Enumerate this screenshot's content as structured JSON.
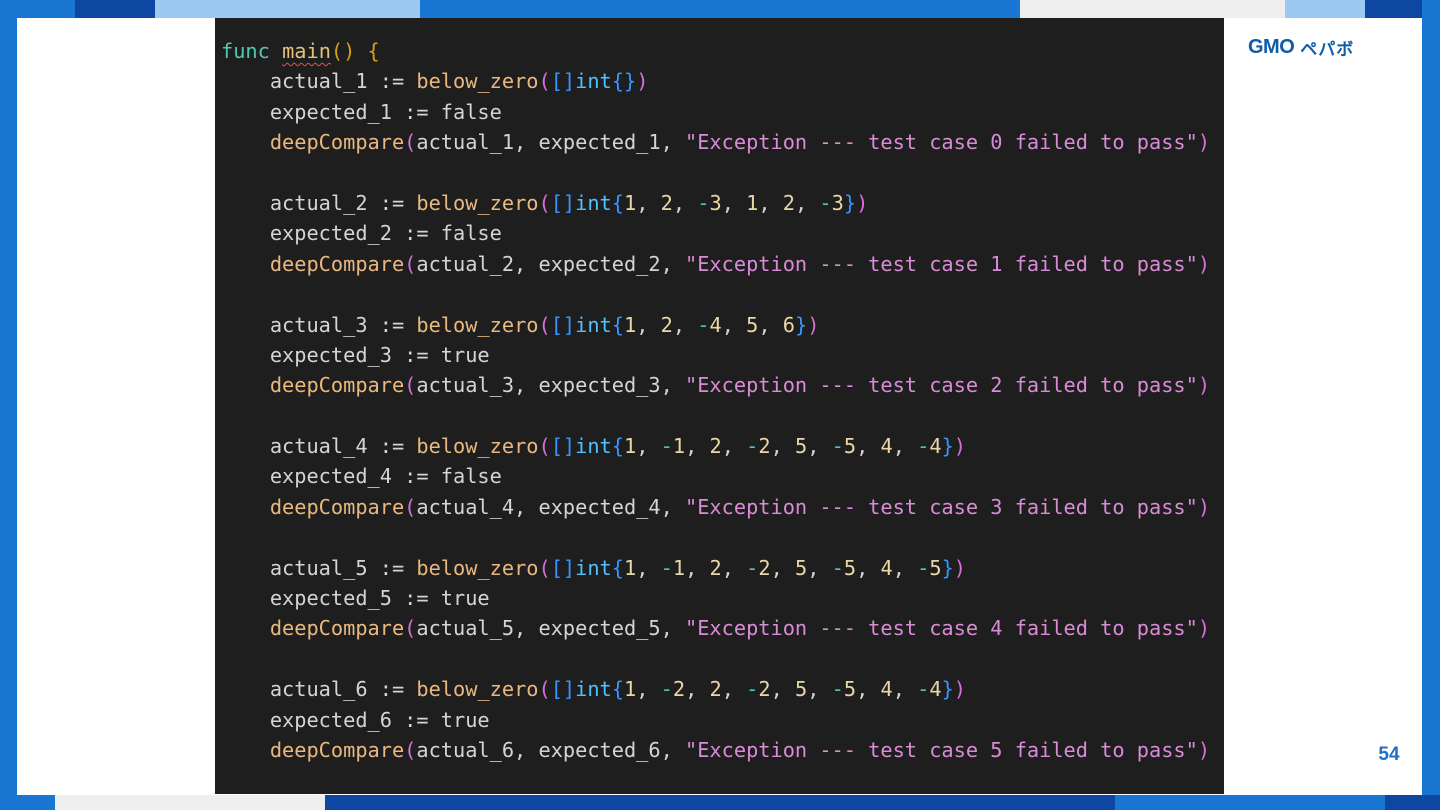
{
  "colors": {
    "frame_blue": "#1976d2",
    "frame_light_blue": "#9cc9f2",
    "frame_dark_blue": "#0d47a1",
    "slide_background": "#ffffff",
    "code_background": "#1e1e1e",
    "brand_blue": "#0f5ca8",
    "page_number": "#1f6fc5"
  },
  "brand": {
    "logo_latin": "GMO",
    "logo_japanese": "ペパボ"
  },
  "page_number": "54",
  "code": {
    "language": "go",
    "lines": [
      [
        {
          "t": "func",
          "c": "kw"
        },
        {
          "t": " ",
          "c": "plain"
        },
        {
          "t": "main",
          "c": "fn",
          "sq": true
        },
        {
          "t": "()",
          "c": "br1"
        },
        {
          "t": " ",
          "c": "plain"
        },
        {
          "t": "{",
          "c": "br1"
        }
      ],
      [
        {
          "t": "    actual_1 ",
          "c": "id"
        },
        {
          "t": ":=",
          "c": "op"
        },
        {
          "t": " ",
          "c": "plain"
        },
        {
          "t": "below_zero",
          "c": "call"
        },
        {
          "t": "(",
          "c": "br2"
        },
        {
          "t": "[]",
          "c": "br3"
        },
        {
          "t": "int",
          "c": "type"
        },
        {
          "t": "{}",
          "c": "br3"
        },
        {
          "t": ")",
          "c": "br2"
        }
      ],
      [
        {
          "t": "    expected_1 ",
          "c": "id"
        },
        {
          "t": ":=",
          "c": "op"
        },
        {
          "t": " false",
          "c": "id"
        }
      ],
      [
        {
          "t": "    deepCompare",
          "c": "call"
        },
        {
          "t": "(",
          "c": "br2"
        },
        {
          "t": "actual_1, expected_1, ",
          "c": "id"
        },
        {
          "t": "\"Exception --- test case 0 failed to pass\"",
          "c": "str"
        },
        {
          "t": ")",
          "c": "br2"
        }
      ],
      [],
      [
        {
          "t": "    actual_2 ",
          "c": "id"
        },
        {
          "t": ":=",
          "c": "op"
        },
        {
          "t": " ",
          "c": "plain"
        },
        {
          "t": "below_zero",
          "c": "call"
        },
        {
          "t": "(",
          "c": "br2"
        },
        {
          "t": "[]",
          "c": "br3"
        },
        {
          "t": "int",
          "c": "type"
        },
        {
          "t": "{",
          "c": "br3"
        },
        {
          "t": "1",
          "c": "num"
        },
        {
          "t": ", ",
          "c": "id"
        },
        {
          "t": "2",
          "c": "num"
        },
        {
          "t": ", ",
          "c": "id"
        },
        {
          "t": "-",
          "c": "neg"
        },
        {
          "t": "3",
          "c": "num"
        },
        {
          "t": ", ",
          "c": "id"
        },
        {
          "t": "1",
          "c": "num"
        },
        {
          "t": ", ",
          "c": "id"
        },
        {
          "t": "2",
          "c": "num"
        },
        {
          "t": ", ",
          "c": "id"
        },
        {
          "t": "-",
          "c": "neg"
        },
        {
          "t": "3",
          "c": "num"
        },
        {
          "t": "}",
          "c": "br3"
        },
        {
          "t": ")",
          "c": "br2"
        }
      ],
      [
        {
          "t": "    expected_2 ",
          "c": "id"
        },
        {
          "t": ":=",
          "c": "op"
        },
        {
          "t": " false",
          "c": "id"
        }
      ],
      [
        {
          "t": "    deepCompare",
          "c": "call"
        },
        {
          "t": "(",
          "c": "br2"
        },
        {
          "t": "actual_2, expected_2, ",
          "c": "id"
        },
        {
          "t": "\"Exception --- test case 1 failed to pass\"",
          "c": "str"
        },
        {
          "t": ")",
          "c": "br2"
        }
      ],
      [],
      [
        {
          "t": "    actual_3 ",
          "c": "id"
        },
        {
          "t": ":=",
          "c": "op"
        },
        {
          "t": " ",
          "c": "plain"
        },
        {
          "t": "below_zero",
          "c": "call"
        },
        {
          "t": "(",
          "c": "br2"
        },
        {
          "t": "[]",
          "c": "br3"
        },
        {
          "t": "int",
          "c": "type"
        },
        {
          "t": "{",
          "c": "br3"
        },
        {
          "t": "1",
          "c": "num"
        },
        {
          "t": ", ",
          "c": "id"
        },
        {
          "t": "2",
          "c": "num"
        },
        {
          "t": ", ",
          "c": "id"
        },
        {
          "t": "-",
          "c": "neg"
        },
        {
          "t": "4",
          "c": "num"
        },
        {
          "t": ", ",
          "c": "id"
        },
        {
          "t": "5",
          "c": "num"
        },
        {
          "t": ", ",
          "c": "id"
        },
        {
          "t": "6",
          "c": "num"
        },
        {
          "t": "}",
          "c": "br3"
        },
        {
          "t": ")",
          "c": "br2"
        }
      ],
      [
        {
          "t": "    expected_3 ",
          "c": "id"
        },
        {
          "t": ":=",
          "c": "op"
        },
        {
          "t": " true",
          "c": "id"
        }
      ],
      [
        {
          "t": "    deepCompare",
          "c": "call"
        },
        {
          "t": "(",
          "c": "br2"
        },
        {
          "t": "actual_3, expected_3, ",
          "c": "id"
        },
        {
          "t": "\"Exception --- test case 2 failed to pass\"",
          "c": "str"
        },
        {
          "t": ")",
          "c": "br2"
        }
      ],
      [],
      [
        {
          "t": "    actual_4 ",
          "c": "id"
        },
        {
          "t": ":=",
          "c": "op"
        },
        {
          "t": " ",
          "c": "plain"
        },
        {
          "t": "below_zero",
          "c": "call"
        },
        {
          "t": "(",
          "c": "br2"
        },
        {
          "t": "[]",
          "c": "br3"
        },
        {
          "t": "int",
          "c": "type"
        },
        {
          "t": "{",
          "c": "br3"
        },
        {
          "t": "1",
          "c": "num"
        },
        {
          "t": ", ",
          "c": "id"
        },
        {
          "t": "-",
          "c": "neg"
        },
        {
          "t": "1",
          "c": "num"
        },
        {
          "t": ", ",
          "c": "id"
        },
        {
          "t": "2",
          "c": "num"
        },
        {
          "t": ", ",
          "c": "id"
        },
        {
          "t": "-",
          "c": "neg"
        },
        {
          "t": "2",
          "c": "num"
        },
        {
          "t": ", ",
          "c": "id"
        },
        {
          "t": "5",
          "c": "num"
        },
        {
          "t": ", ",
          "c": "id"
        },
        {
          "t": "-",
          "c": "neg"
        },
        {
          "t": "5",
          "c": "num"
        },
        {
          "t": ", ",
          "c": "id"
        },
        {
          "t": "4",
          "c": "num"
        },
        {
          "t": ", ",
          "c": "id"
        },
        {
          "t": "-",
          "c": "neg"
        },
        {
          "t": "4",
          "c": "num"
        },
        {
          "t": "}",
          "c": "br3"
        },
        {
          "t": ")",
          "c": "br2"
        }
      ],
      [
        {
          "t": "    expected_4 ",
          "c": "id"
        },
        {
          "t": ":=",
          "c": "op"
        },
        {
          "t": " false",
          "c": "id"
        }
      ],
      [
        {
          "t": "    deepCompare",
          "c": "call"
        },
        {
          "t": "(",
          "c": "br2"
        },
        {
          "t": "actual_4, expected_4, ",
          "c": "id"
        },
        {
          "t": "\"Exception --- test case 3 failed to pass\"",
          "c": "str"
        },
        {
          "t": ")",
          "c": "br2"
        }
      ],
      [],
      [
        {
          "t": "    actual_5 ",
          "c": "id"
        },
        {
          "t": ":=",
          "c": "op"
        },
        {
          "t": " ",
          "c": "plain"
        },
        {
          "t": "below_zero",
          "c": "call"
        },
        {
          "t": "(",
          "c": "br2"
        },
        {
          "t": "[]",
          "c": "br3"
        },
        {
          "t": "int",
          "c": "type"
        },
        {
          "t": "{",
          "c": "br3"
        },
        {
          "t": "1",
          "c": "num"
        },
        {
          "t": ", ",
          "c": "id"
        },
        {
          "t": "-",
          "c": "neg"
        },
        {
          "t": "1",
          "c": "num"
        },
        {
          "t": ", ",
          "c": "id"
        },
        {
          "t": "2",
          "c": "num"
        },
        {
          "t": ", ",
          "c": "id"
        },
        {
          "t": "-",
          "c": "neg"
        },
        {
          "t": "2",
          "c": "num"
        },
        {
          "t": ", ",
          "c": "id"
        },
        {
          "t": "5",
          "c": "num"
        },
        {
          "t": ", ",
          "c": "id"
        },
        {
          "t": "-",
          "c": "neg"
        },
        {
          "t": "5",
          "c": "num"
        },
        {
          "t": ", ",
          "c": "id"
        },
        {
          "t": "4",
          "c": "num"
        },
        {
          "t": ", ",
          "c": "id"
        },
        {
          "t": "-",
          "c": "neg"
        },
        {
          "t": "5",
          "c": "num"
        },
        {
          "t": "}",
          "c": "br3"
        },
        {
          "t": ")",
          "c": "br2"
        }
      ],
      [
        {
          "t": "    expected_5 ",
          "c": "id"
        },
        {
          "t": ":=",
          "c": "op"
        },
        {
          "t": " true",
          "c": "id"
        }
      ],
      [
        {
          "t": "    deepCompare",
          "c": "call"
        },
        {
          "t": "(",
          "c": "br2"
        },
        {
          "t": "actual_5, expected_5, ",
          "c": "id"
        },
        {
          "t": "\"Exception --- test case 4 failed to pass\"",
          "c": "str"
        },
        {
          "t": ")",
          "c": "br2"
        }
      ],
      [],
      [
        {
          "t": "    actual_6 ",
          "c": "id"
        },
        {
          "t": ":=",
          "c": "op"
        },
        {
          "t": " ",
          "c": "plain"
        },
        {
          "t": "below_zero",
          "c": "call"
        },
        {
          "t": "(",
          "c": "br2"
        },
        {
          "t": "[]",
          "c": "br3"
        },
        {
          "t": "int",
          "c": "type"
        },
        {
          "t": "{",
          "c": "br3"
        },
        {
          "t": "1",
          "c": "num"
        },
        {
          "t": ", ",
          "c": "id"
        },
        {
          "t": "-",
          "c": "neg"
        },
        {
          "t": "2",
          "c": "num"
        },
        {
          "t": ", ",
          "c": "id"
        },
        {
          "t": "2",
          "c": "num"
        },
        {
          "t": ", ",
          "c": "id"
        },
        {
          "t": "-",
          "c": "neg"
        },
        {
          "t": "2",
          "c": "num"
        },
        {
          "t": ", ",
          "c": "id"
        },
        {
          "t": "5",
          "c": "num"
        },
        {
          "t": ", ",
          "c": "id"
        },
        {
          "t": "-",
          "c": "neg"
        },
        {
          "t": "5",
          "c": "num"
        },
        {
          "t": ", ",
          "c": "id"
        },
        {
          "t": "4",
          "c": "num"
        },
        {
          "t": ", ",
          "c": "id"
        },
        {
          "t": "-",
          "c": "neg"
        },
        {
          "t": "4",
          "c": "num"
        },
        {
          "t": "}",
          "c": "br3"
        },
        {
          "t": ")",
          "c": "br2"
        }
      ],
      [
        {
          "t": "    expected_6 ",
          "c": "id"
        },
        {
          "t": ":=",
          "c": "op"
        },
        {
          "t": " true",
          "c": "id"
        }
      ],
      [
        {
          "t": "    deepCompare",
          "c": "call"
        },
        {
          "t": "(",
          "c": "br2"
        },
        {
          "t": "actual_6, expected_6, ",
          "c": "id"
        },
        {
          "t": "\"Exception --- test case 5 failed to pass\"",
          "c": "str"
        },
        {
          "t": ")",
          "c": "br2"
        }
      ],
      [],
      [
        {
          "t": "}",
          "c": "br1"
        }
      ]
    ]
  }
}
